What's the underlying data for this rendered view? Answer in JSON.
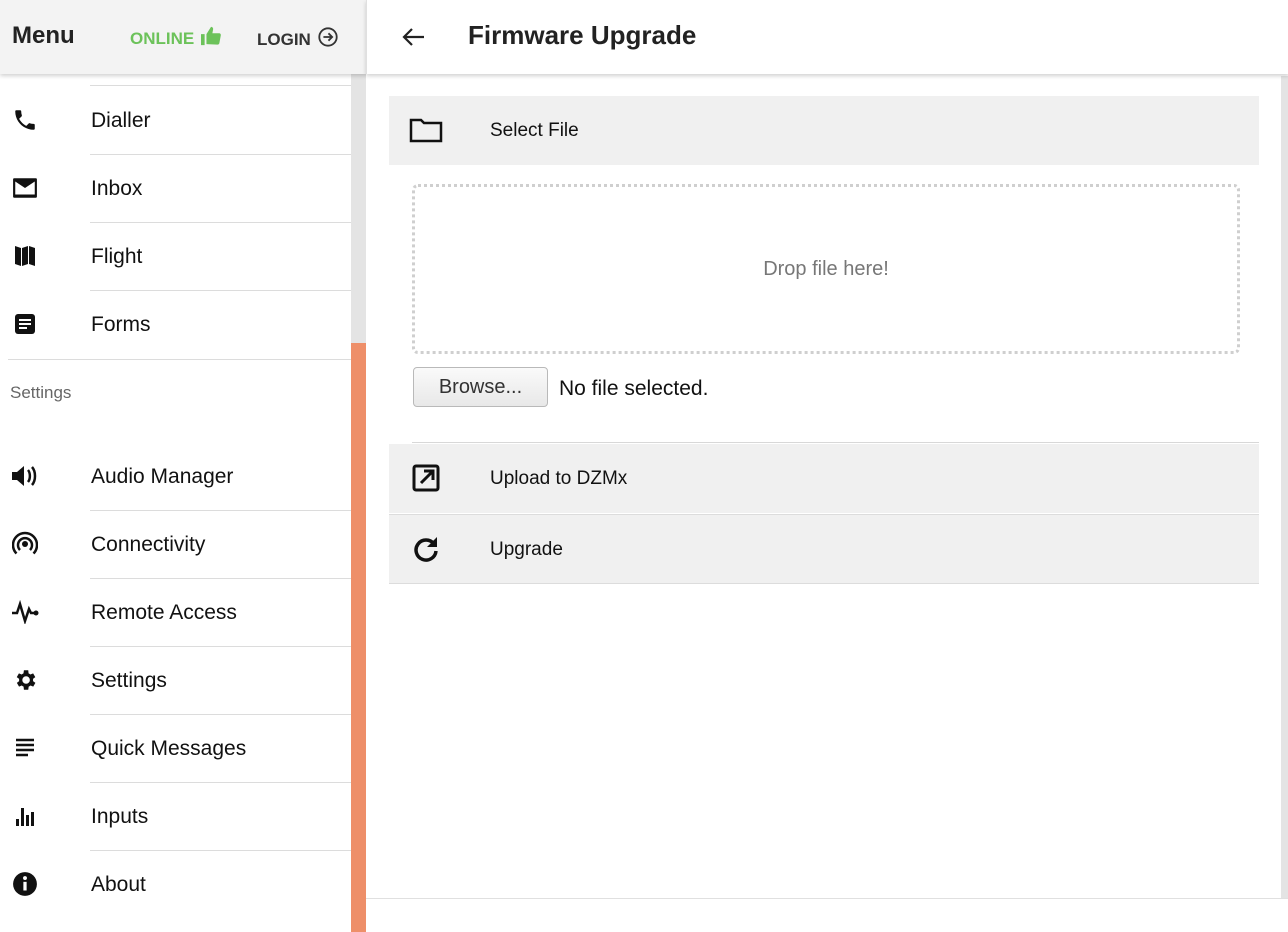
{
  "sidebar": {
    "title": "Menu",
    "status": {
      "online_label": "ONLINE",
      "login_label": "LOGIN",
      "online_color": "#6cc25a"
    },
    "items_top": [
      {
        "label": "Dialler",
        "icon": "phone-icon"
      },
      {
        "label": "Inbox",
        "icon": "mail-icon"
      },
      {
        "label": "Flight",
        "icon": "map-icon"
      },
      {
        "label": "Forms",
        "icon": "forms-icon"
      }
    ],
    "section_label": "Settings",
    "items_settings": [
      {
        "label": "Audio Manager",
        "icon": "speaker-icon"
      },
      {
        "label": "Connectivity",
        "icon": "signal-icon"
      },
      {
        "label": "Remote Access",
        "icon": "pulse-icon"
      },
      {
        "label": "Settings",
        "icon": "gear-icon"
      },
      {
        "label": "Quick Messages",
        "icon": "text-lines-icon"
      },
      {
        "label": "Inputs",
        "icon": "bar-chart-icon"
      },
      {
        "label": "About",
        "icon": "info-icon"
      }
    ],
    "scroll_accent": "#ee8f69"
  },
  "header": {
    "title": "Firmware Upgrade"
  },
  "main": {
    "select_file_label": "Select File",
    "dropzone_text": "Drop file here!",
    "browse_label": "Browse...",
    "file_status": "No file selected.",
    "upload_label": "Upload to DZMx",
    "upgrade_label": "Upgrade"
  }
}
